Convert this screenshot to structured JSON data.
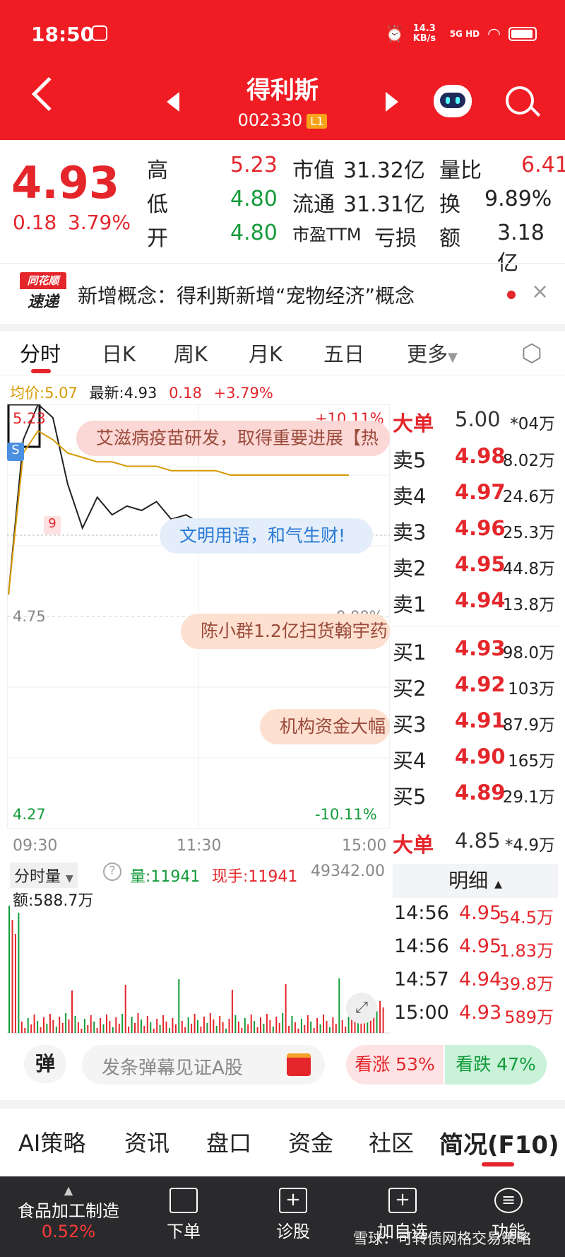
{
  "status": {
    "time": "18:50",
    "net_speed": "14.3 KB/s",
    "signal": "5G HD"
  },
  "header": {
    "title": "得利斯",
    "code": "002330",
    "level": "L1"
  },
  "quote": {
    "price": "4.93",
    "change": "0.18",
    "change_pct": "3.79%",
    "rows": [
      {
        "k1": "高",
        "v1": "5.23",
        "k2": "市值",
        "v2": "31.32亿",
        "k3": "量比",
        "v3": "6.41"
      },
      {
        "k1": "低",
        "v1": "4.80",
        "k2": "流通",
        "v2": "31.31亿",
        "k3": "换",
        "v3": "9.89%"
      },
      {
        "k1": "开",
        "v1": "4.80",
        "k2": "市盈TTM",
        "v2": "亏损",
        "k3": "额",
        "v3": "3.18亿"
      }
    ]
  },
  "news": {
    "logo_top": "同花顺",
    "logo_bottom": "速递",
    "text": "新增概念：得利斯新增“宠物经济”概念"
  },
  "tabs": [
    "分时",
    "日K",
    "周K",
    "月K",
    "五日",
    "更多"
  ],
  "chart_info": {
    "avg_label": "均价:5.07",
    "latest_label": "最新:4.93",
    "change": "0.18",
    "change_pct": "+3.79%"
  },
  "chart_data": {
    "type": "line",
    "series": [
      {
        "name": "价格",
        "values": [
          4.8,
          5.15,
          5.23,
          5.2,
          5.05,
          4.95,
          5.02,
          4.98,
          5.0,
          4.99,
          5.01,
          4.97,
          4.98,
          4.96,
          4.95,
          4.94,
          4.93,
          4.93,
          4.94,
          4.93,
          4.93,
          4.94,
          4.93,
          4.93
        ]
      },
      {
        "name": "均价",
        "values": [
          4.8,
          5.12,
          5.17,
          5.15,
          5.12,
          5.11,
          5.1,
          5.1,
          5.09,
          5.09,
          5.09,
          5.08,
          5.08,
          5.08,
          5.08,
          5.07,
          5.07,
          5.07,
          5.07,
          5.07,
          5.07,
          5.07,
          5.07,
          5.07
        ]
      }
    ],
    "xlabels": [
      "09:30",
      "11:30",
      "15:00"
    ],
    "ylim": [
      4.27,
      5.23
    ],
    "labels": {
      "high": "5.23",
      "mid": "4.75",
      "low": "4.27",
      "pct_high": "+10.11%",
      "pct_mid": "0.00%",
      "pct_low": "-10.11%"
    },
    "marker_s": "S",
    "marker_9": "9"
  },
  "bubbles": [
    {
      "text": "艾滋病疫苗研发，取得重要进展【热",
      "color": "#fbd7d5"
    },
    {
      "text": "文明用语，和气生财!",
      "color": "#e4eefb"
    },
    {
      "text": "陈小群1.2亿扫货翰宇药",
      "color": "#fde0d0"
    },
    {
      "text": "机构资金大幅",
      "color": "#fde0d0"
    }
  ],
  "orderbook": {
    "big_top": {
      "label": "大单",
      "price": "5.00",
      "vol": "*04万"
    },
    "asks": [
      {
        "label": "卖5",
        "price": "4.98",
        "vol": "8.02万"
      },
      {
        "label": "卖4",
        "price": "4.97",
        "vol": "24.6万"
      },
      {
        "label": "卖3",
        "price": "4.96",
        "vol": "25.3万"
      },
      {
        "label": "卖2",
        "price": "4.95",
        "vol": "44.8万"
      },
      {
        "label": "卖1",
        "price": "4.94",
        "vol": "13.8万"
      }
    ],
    "bids": [
      {
        "label": "买1",
        "price": "4.93",
        "vol": "98.0万"
      },
      {
        "label": "买2",
        "price": "4.92",
        "vol": "103万"
      },
      {
        "label": "买3",
        "price": "4.91",
        "vol": "87.9万"
      },
      {
        "label": "买4",
        "price": "4.90",
        "vol": "165万"
      },
      {
        "label": "买5",
        "price": "4.89",
        "vol": "29.1万"
      }
    ],
    "big_bottom": {
      "label": "大单",
      "price": "4.85",
      "vol": "*4.9万"
    }
  },
  "volume": {
    "selector": "分时量",
    "vol": "量:11941",
    "hand": "现手:11941",
    "max": "49342.00",
    "amount": "额:588.7万"
  },
  "detail": {
    "title": "明细",
    "rows": [
      {
        "time": "14:56",
        "price": "4.95",
        "vol": "54.5万"
      },
      {
        "time": "14:56",
        "price": "4.95",
        "vol": "1.83万"
      },
      {
        "time": "14:57",
        "price": "4.94",
        "vol": "39.8万"
      },
      {
        "time": "15:00",
        "price": "4.93",
        "vol": "589万"
      }
    ]
  },
  "danmu": {
    "label": "弹",
    "placeholder": "发条弹幕见证A股",
    "up": "看涨 53%",
    "down": "看跌 47%"
  },
  "bottom_tabs": [
    "AI策略",
    "资讯",
    "盘口",
    "资金",
    "社区",
    "简况(F10)"
  ],
  "nav": {
    "sector": "食品加工制造",
    "sector_pct": "0.52%",
    "items": [
      "下单",
      "诊股",
      "加自选",
      "功能"
    ],
    "watermark": "雪球：可转债网格交易策略"
  }
}
